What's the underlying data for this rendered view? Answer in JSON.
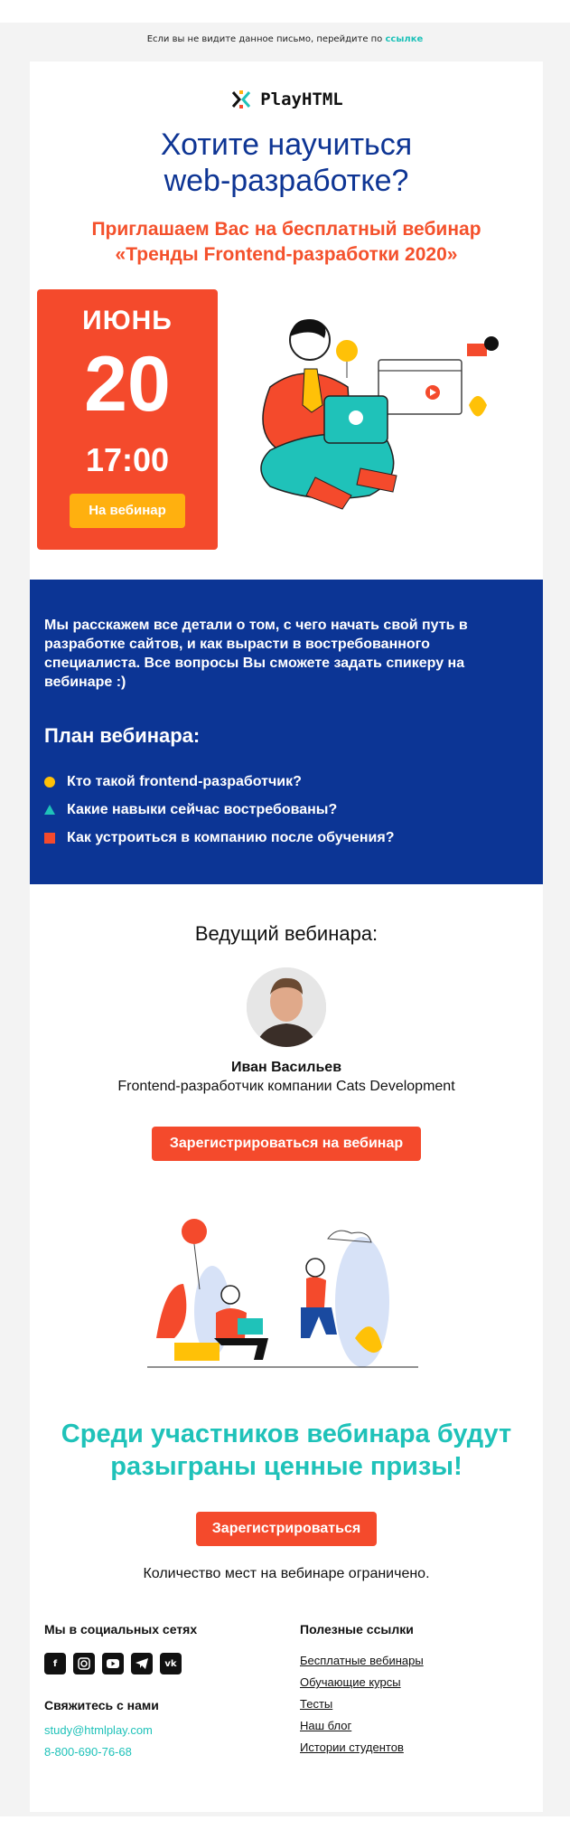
{
  "preheader": {
    "text": "Если вы не видите данное письмо, перейдите по",
    "link": "ссылке"
  },
  "logo": {
    "text": "PlayHTML"
  },
  "headline": {
    "line1": "Хотите научиться",
    "line2": "web-разработке?"
  },
  "subheadline": {
    "line1": "Приглашаем Вас на бесплатный вебинар",
    "line2": "«Тренды Frontend-разработки 2020»"
  },
  "event": {
    "month": "ИЮНЬ",
    "day": "20",
    "time": "17:00",
    "button": "На вебинар"
  },
  "intro": {
    "text": "Мы расскажем все детали о том, с чего начать свой путь в разработке сайтов, и как вырасти в востребованного специалиста. Все вопросы Вы сможете задать спикеру на вебинаре :)"
  },
  "plan": {
    "title": "План вебинара:",
    "items": [
      "Кто такой frontend-разработчик?",
      "Какие навыки сейчас востребованы?",
      "Как устроиться в компанию после обучения?"
    ]
  },
  "host": {
    "title": "Ведущий вебинара:",
    "name": "Иван Васильев",
    "role": "Frontend-разработчик компании Cats Development",
    "button": "Зарегистрироваться на вебинар"
  },
  "prize": {
    "line1": "Среди участников вебинара будут",
    "line2": "разыграны ценные призы!",
    "button": "Зарегистрироваться"
  },
  "limit": {
    "text": "Количество мест на вебинаре ограничено."
  },
  "footer": {
    "social_title": "Мы в социальных сетях",
    "social_icons": [
      "facebook-icon",
      "instagram-icon",
      "youtube-icon",
      "telegram-icon",
      "vk-icon"
    ],
    "contact_title": "Свяжитесь с нами",
    "email": "study@htmlplay.com",
    "phone": "8-800-690-76-68",
    "links_title": "Полезные ссылки",
    "links": [
      "Бесплатные вебинары",
      "Обучающие курсы",
      "Тесты",
      "Наш блог",
      "Истории студентов"
    ]
  },
  "colors": {
    "blue": "#0c3595",
    "red": "#f44a2c",
    "teal": "#1fc2b9",
    "yellow": "#ffb00f"
  }
}
